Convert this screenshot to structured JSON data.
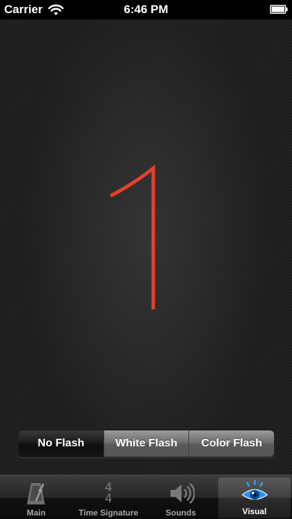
{
  "status_bar": {
    "carrier": "Carrier",
    "time": "6:46 PM"
  },
  "display": {
    "beat_number": "1",
    "beat_color": "#e8402a"
  },
  "flash_modes": {
    "options": [
      "No Flash",
      "White Flash",
      "Color Flash"
    ],
    "selected": "No Flash"
  },
  "tab_bar": {
    "tabs": [
      {
        "label": "Main",
        "icon": "metronome-icon"
      },
      {
        "label": "Time Signature",
        "icon": "time-signature-icon",
        "numerator": "4",
        "denominator": "4"
      },
      {
        "label": "Sounds",
        "icon": "speaker-icon"
      },
      {
        "label": "Visual",
        "icon": "eye-icon"
      }
    ],
    "selected": "Visual"
  }
}
